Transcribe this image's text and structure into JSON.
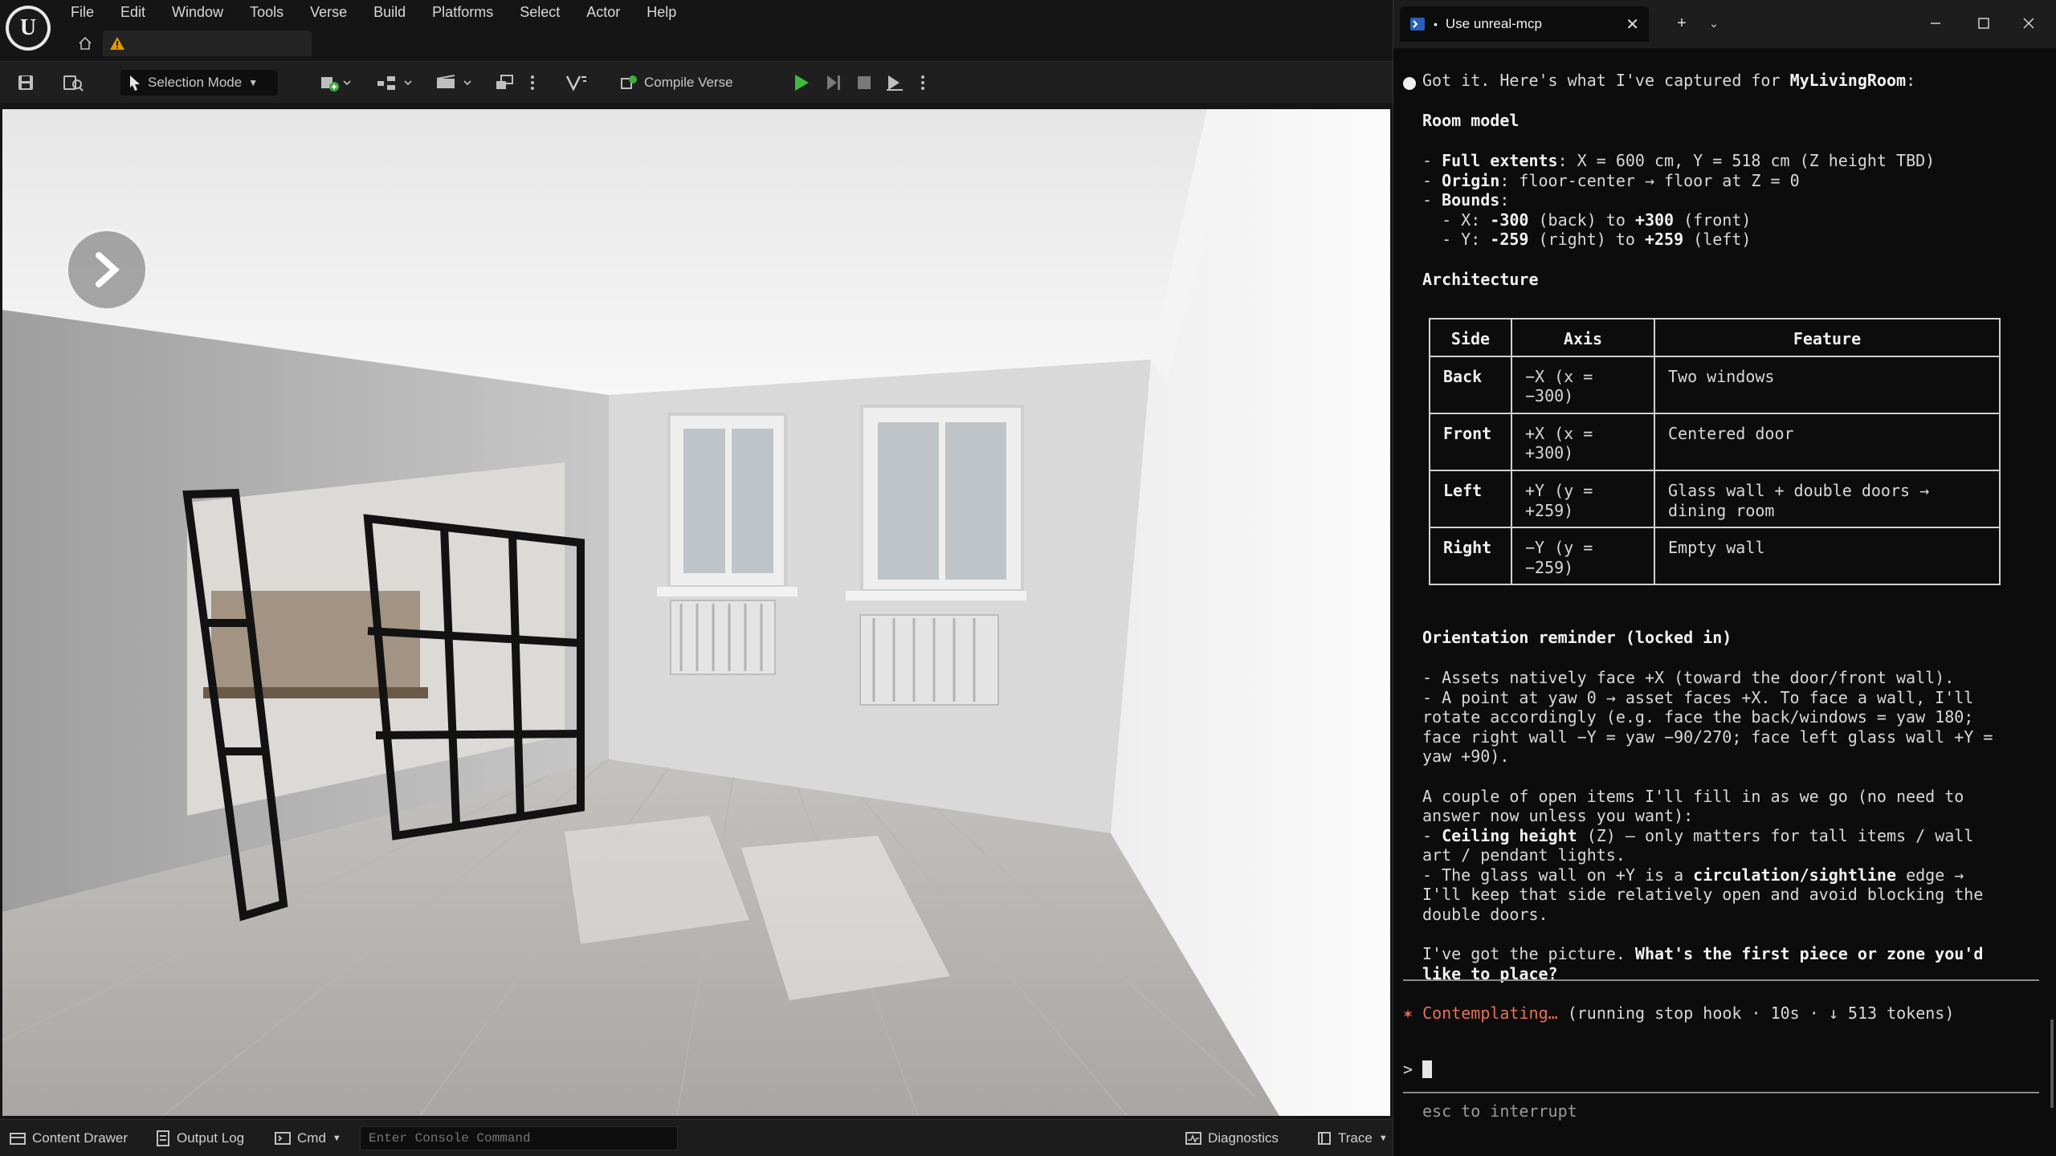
{
  "ue": {
    "menu": [
      "File",
      "Edit",
      "Window",
      "Tools",
      "Verse",
      "Build",
      "Platforms",
      "Select",
      "Actor",
      "Help"
    ],
    "toolbar": {
      "selection_mode": "Selection Mode",
      "compile_verse": "Compile Verse"
    },
    "statusbar": {
      "content_drawer": "Content Drawer",
      "output_log": "Output Log",
      "cmd": "Cmd",
      "console_placeholder": "Enter Console Command",
      "diagnostics": "Diagnostics",
      "trace": "Trace"
    }
  },
  "terminal": {
    "tab_title": "Use unreal-mcp",
    "intro": "Got it. Here's what I've captured for ",
    "room_name": "MyLivingRoom",
    "room_model_heading": "Room model",
    "room_lines": [
      {
        "bold": "Full extents",
        "rest": ": X = 600 cm, Y = 518 cm (Z height TBD)"
      },
      {
        "bold": "Origin",
        "rest": ": floor-center → floor at Z = 0"
      },
      {
        "bold": "Bounds",
        "rest": ":"
      }
    ],
    "bounds_x": {
      "label": "X: ",
      "v1": "-300",
      "mid1": " (back) to ",
      "v2": "+300",
      "end": " (front)"
    },
    "bounds_y": {
      "label": "Y: ",
      "v1": "-259",
      "mid1": " (right) to ",
      "v2": "+259",
      "end": " (left)"
    },
    "architecture_heading": "Architecture",
    "table": {
      "headers": [
        "Side",
        "Axis",
        "Feature"
      ],
      "rows": [
        {
          "side": "Back",
          "axis1": "−X (x =",
          "axis2": "−300)",
          "feat1": "Two windows",
          "feat2": ""
        },
        {
          "side": "Front",
          "axis1": "+X (x =",
          "axis2": "+300)",
          "feat1": "Centered door",
          "feat2": ""
        },
        {
          "side": "Left",
          "axis1": "+Y (y =",
          "axis2": "+259)",
          "feat1": "Glass wall + double doors →",
          "feat2": "dining room"
        },
        {
          "side": "Right",
          "axis1": "−Y (y =",
          "axis2": "−259)",
          "feat1": "Empty wall",
          "feat2": ""
        }
      ]
    },
    "orientation_heading": "Orientation reminder (locked in)",
    "orientation_lines": [
      "- Assets natively face +X (toward the door/front wall).",
      "- A point at yaw 0 → asset faces +X. To face a wall, I'll",
      "rotate accordingly (e.g. face the back/windows = yaw 180;",
      "face right wall −Y = yaw −90/270; face left glass wall +Y =",
      "yaw +90)."
    ],
    "open_items_lines": [
      "A couple of open items I'll fill in as we go (no need to",
      "answer now unless you want):"
    ],
    "ceiling": {
      "bold": "Ceiling height",
      "rest": " (Z) — only matters for tall items / wall"
    },
    "ceiling_cont": "art / pendant lights.",
    "glass": {
      "pre": "- The glass wall on +Y is a ",
      "bold": "circulation/sightline",
      "rest": " edge →"
    },
    "glass_cont": [
      "I'll keep that side relatively open and avoid blocking the",
      "double doors."
    ],
    "question": {
      "pre": "I've got the picture. ",
      "bold": "What's the first piece or zone you'd"
    },
    "question_cont": "like to place?",
    "status": {
      "star": "✶",
      "word": "Contemplating…",
      "detail": " (running stop hook · 10s · ↓ 513 tokens)"
    },
    "prompt_symbol": ">",
    "hint": "esc to interrupt"
  }
}
